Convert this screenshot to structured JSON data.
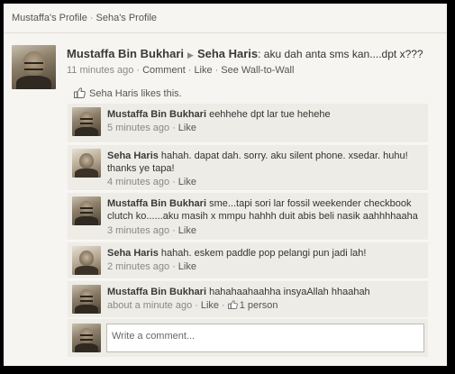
{
  "breadcrumb": {
    "items": [
      "Mustaffa's Profile",
      "Seha's Profile"
    ],
    "separator": "·"
  },
  "post": {
    "author": "Mustaffa Bin Bukhari",
    "target": "Seha Haris",
    "text": ": aku dah anta sms kan....dpt x???",
    "time": "11 minutes ago",
    "actions": {
      "comment": "Comment",
      "like": "Like",
      "wall": "See Wall-to-Wall"
    },
    "likes_text": "Seha Haris likes this."
  },
  "comments": [
    {
      "author": "Mustaffa Bin Bukhari",
      "text": " eehhehe dpt lar tue hehehe",
      "time": "5 minutes ago",
      "like": "Like",
      "avatar": "mustaffa"
    },
    {
      "author": "Seha Haris",
      "text": " hahah. dapat dah. sorry. aku silent phone. xsedar. huhu! thanks ye tapa!",
      "time": "4 minutes ago",
      "like": "Like",
      "avatar": "seha"
    },
    {
      "author": "Mustaffa Bin Bukhari",
      "text": " sme...tapi sori lar fossil weekender checkbook clutch ko......aku masih x mmpu hahhh duit abis beli nasik aahhhhaaha",
      "time": "3 minutes ago",
      "like": "Like",
      "avatar": "mustaffa"
    },
    {
      "author": "Seha Haris",
      "text": " hahah. eskem paddle pop pelangi pun jadi lah!",
      "time": "2 minutes ago",
      "like": "Like",
      "avatar": "seha"
    },
    {
      "author": "Mustaffa Bin Bukhari",
      "text": " hahahaahaahha insyaAllah hhaahah",
      "time": "about a minute ago",
      "like": "Like",
      "like_count": "1 person",
      "avatar": "mustaffa"
    }
  ],
  "composer": {
    "placeholder": "Write a comment..."
  },
  "colors": {
    "background": "#f6f5f1",
    "comment_bg": "#eeece6",
    "frame": "#000000"
  }
}
